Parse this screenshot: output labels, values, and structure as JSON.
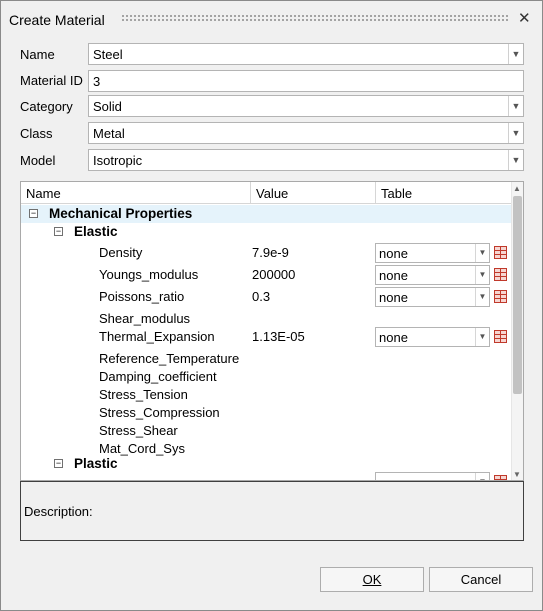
{
  "dialog": {
    "title": "Create Material",
    "close_glyph": "✕",
    "fields": {
      "name": {
        "label": "Name",
        "value": "Steel"
      },
      "material_id": {
        "label": "Material ID",
        "value": "3"
      },
      "category": {
        "label": "Category",
        "value": "Solid"
      },
      "class": {
        "label": "Class",
        "value": "Metal"
      },
      "model": {
        "label": "Model",
        "value": "Isotropic"
      }
    },
    "tree": {
      "columns": {
        "name": "Name",
        "value": "Value",
        "table": "Table"
      },
      "mechanical_label": "Mechanical Properties",
      "elastic_label": "Elastic",
      "plastic_label": "Plastic",
      "elastic_props": [
        {
          "name": "Density",
          "value": "7.9e-9",
          "table": "none"
        },
        {
          "name": "Youngs_modulus",
          "value": "200000",
          "table": "none"
        },
        {
          "name": "Poissons_ratio",
          "value": "0.3",
          "table": "none"
        },
        {
          "name": "Shear_modulus",
          "value": "",
          "table": ""
        },
        {
          "name": "Thermal_Expansion",
          "value": "1.13E-05",
          "table": "none"
        },
        {
          "name": "Reference_Temperature",
          "value": "",
          "table": ""
        },
        {
          "name": "Damping_coefficient",
          "value": "",
          "table": ""
        },
        {
          "name": "Stress_Tension",
          "value": "",
          "table": ""
        },
        {
          "name": "Stress_Compression",
          "value": "",
          "table": ""
        },
        {
          "name": "Stress_Shear",
          "value": "",
          "table": ""
        },
        {
          "name": "Mat_Cord_Sys",
          "value": "",
          "table": ""
        }
      ]
    },
    "description_label": "Description:",
    "ok_label": "OK",
    "cancel_label": "Cancel",
    "icons": {
      "expander": "minus-box-icon",
      "dropdown": "chevron-down-icon",
      "table_edit": "table-grid-icon"
    }
  }
}
